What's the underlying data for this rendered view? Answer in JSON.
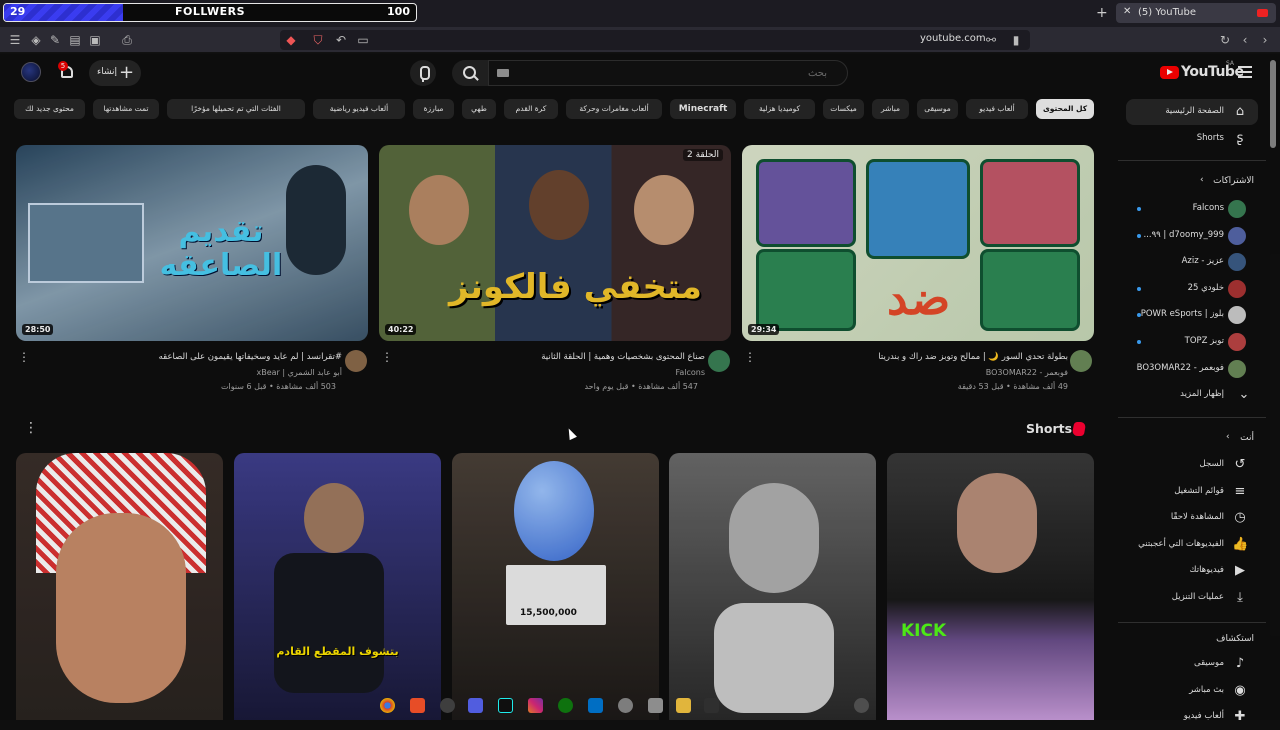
{
  "overlay": {
    "follower_count": "29",
    "label": "FOLLWERS",
    "goal": "100",
    "progress": 0.29
  },
  "browser": {
    "tab_title": "(5) YouTube",
    "url": "youtube.com"
  },
  "header": {
    "logo_text": "YouTube",
    "region": "SA",
    "search_placeholder": "بحث",
    "create_label": "إنشاء",
    "notif_count": "5"
  },
  "chips": [
    "كل المحتوى",
    "ألعاب فيديو",
    "موسيقى",
    "مباشر",
    "ميكسات",
    "كوميديا هزلية",
    "Minecraft",
    "ألعاب مغامرات وحركة",
    "كرة القدم",
    "طهي",
    "مبارزة",
    "ألعاب فيديو رياضية",
    "الفئات التي تم تحميلها مؤخرًا",
    "تمت مشاهدتها",
    "محتوى جديد لك"
  ],
  "videos": [
    {
      "title": "بطولة تحدي السور 🌙 | ممالح وتوبز ضد راك و بندريتا",
      "channel": "فوبعمر - BO3OMAR22",
      "meta": "49 ألف مشاهدة • قبل 53 دقيقة",
      "duration": "29:34"
    },
    {
      "title": "صناع المحتوى بشخصيات وهمية | الحلقة الثانية",
      "channel": "Falcons",
      "meta": "547 ألف مشاهدة • قبل يوم واحد",
      "duration": "40:22"
    },
    {
      "title": "#تقرانسد | لم عايد وسخيفاتها يقيمون على الصاعقه",
      "channel": "أبو عابد الشمري | xBear",
      "meta": "503 ألف مشاهدة • قبل 6 سنوات",
      "duration": "28:50"
    }
  ],
  "thumb_text": {
    "v1": "ضد",
    "v2": "متخفي فالكونز",
    "v2_episode": "الحلقة 2",
    "v3": "تقديم الصاعقه"
  },
  "shorts": {
    "title": "Shorts",
    "overlay_text": [
      "",
      "بتشوف المقطع القادم",
      "15,500,000",
      "",
      "KICK"
    ]
  },
  "sidebar": {
    "home": "الصفحة الرئيسية",
    "shorts": "Shorts",
    "subs_header": "الاشتراكات",
    "subs": [
      {
        "name": "Falcons",
        "color": "#3a7f55",
        "dot": true
      },
      {
        "name": "d7oomy_999 | ٩٩...",
        "color": "#5566aa",
        "dot": true
      },
      {
        "name": "عزيز - Aziz",
        "color": "#3b5c86",
        "dot": false
      },
      {
        "name": "خلودي 25",
        "color": "#a33",
        "dot": true
      },
      {
        "name": "بلوز | POWR eSports",
        "color": "#ccc",
        "dot": true
      },
      {
        "name": "توبز TOPZ",
        "color": "#b44",
        "dot": true
      },
      {
        "name": "فوبعمر - BO3OMAR22",
        "color": "#6b8a5a",
        "dot": false
      }
    ],
    "show_more": "إظهار المزيد",
    "you_header": "أنت",
    "you_items": [
      {
        "label": "السجل",
        "icon": "↺"
      },
      {
        "label": "قوائم التشغيل",
        "icon": "≡"
      },
      {
        "label": "المشاهدة لاحقًا",
        "icon": "◷"
      },
      {
        "label": "الفيديوهات التي أعجبتني",
        "icon": "👍"
      },
      {
        "label": "فيديوهاتك",
        "icon": "▶"
      },
      {
        "label": "عمليات التنزيل",
        "icon": "⤓"
      }
    ],
    "explore_header": "استكشاف",
    "explore_items": [
      {
        "label": "موسيقى",
        "icon": "♪"
      },
      {
        "label": "بث مباشر",
        "icon": "◉"
      },
      {
        "label": "ألعاب فيديو",
        "icon": "✚"
      }
    ]
  }
}
